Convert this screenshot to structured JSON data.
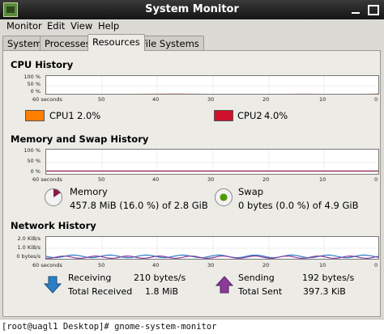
{
  "window": {
    "title": "System Monitor"
  },
  "menu": [
    "Monitor",
    "Edit",
    "View",
    "Help"
  ],
  "tabs": [
    "System",
    "Processes",
    "Resources",
    "File Systems"
  ],
  "active_tab": "Resources",
  "cpu": {
    "title": "CPU History",
    "y_ticks": [
      "100 %",
      "50 %",
      "0 %"
    ],
    "x_ticks": [
      "60 seconds",
      "50",
      "40",
      "30",
      "20",
      "10",
      "0"
    ],
    "cpu1_label": "CPU1",
    "cpu1_value": "2.0%",
    "cpu1_color": "#ff7f00",
    "cpu2_label": "CPU2",
    "cpu2_value": "4.0%",
    "cpu2_color": "#d0112b"
  },
  "memory": {
    "title": "Memory and Swap History",
    "y_ticks": [
      "100 %",
      "50 %",
      "0 %"
    ],
    "x_ticks": [
      "60 seconds",
      "50",
      "40",
      "30",
      "20",
      "10",
      "0"
    ],
    "memory_label": "Memory",
    "memory_value": "457.8 MiB (16.0 %) of 2.8 GiB",
    "memory_color": "#8b1a4a",
    "swap_label": "Swap",
    "swap_value": "0 bytes (0.0 %) of 4.9 GiB",
    "swap_color": "#4e9a06"
  },
  "network": {
    "title": "Network History",
    "y_ticks": [
      "2.0 KiB/s",
      "1.0 KiB/s",
      "0 bytes/s"
    ],
    "x_ticks": [
      "60 seconds",
      "50",
      "40",
      "30",
      "20",
      "10",
      "0"
    ],
    "receiving_label": "Receiving",
    "receiving_value": "210 bytes/s",
    "total_received_label": "Total Received",
    "total_received_value": "1.8 MiB",
    "sending_label": "Sending",
    "sending_value": "192 bytes/s",
    "total_sent_label": "Total Sent",
    "total_sent_value": "397.3 KiB",
    "receive_color": "#2d7fc4",
    "send_color": "#8a3b9a"
  },
  "terminal": {
    "text": "[root@uagl1 Desktop]# gnome-system-monitor"
  }
}
